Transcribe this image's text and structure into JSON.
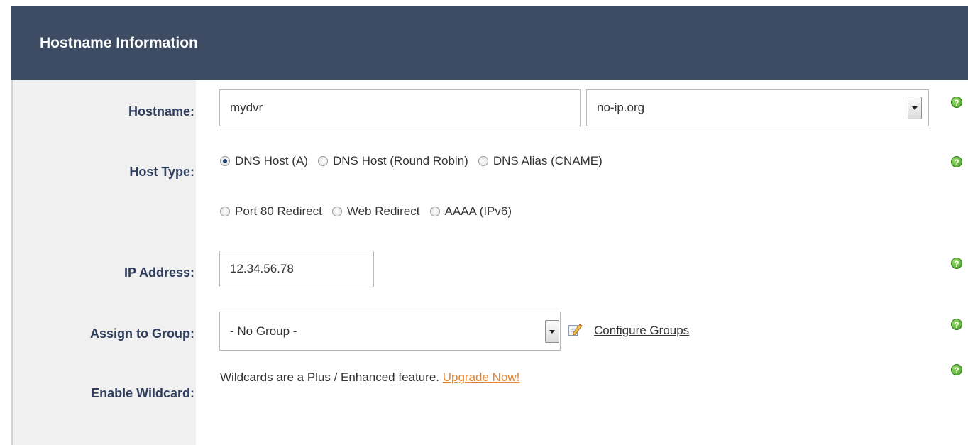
{
  "header": {
    "title": "Hostname Information"
  },
  "fields": {
    "hostname": {
      "label": "Hostname:",
      "value": "mydvr",
      "domain": "no-ip.org"
    },
    "host_type": {
      "label": "Host Type:",
      "options": [
        {
          "label": "DNS Host (A)",
          "checked": true
        },
        {
          "label": "DNS Host (Round Robin)",
          "checked": false
        },
        {
          "label": "DNS Alias (CNAME)",
          "checked": false
        },
        {
          "label": "Port 80 Redirect",
          "checked": false
        },
        {
          "label": "Web Redirect",
          "checked": false
        },
        {
          "label": "AAAA (IPv6)",
          "checked": false
        }
      ]
    },
    "ip_address": {
      "label": "IP Address:",
      "value": "12.34.56.78"
    },
    "group": {
      "label": "Assign to Group:",
      "value": "- No Group -",
      "configure_link": "Configure Groups"
    },
    "wildcard": {
      "label": "Enable Wildcard:",
      "message": "Wildcards are a Plus / Enhanced feature.",
      "upgrade_link": "Upgrade Now!"
    }
  },
  "icons": {
    "help": "help-icon",
    "edit": "edit-icon"
  },
  "colors": {
    "header_bg": "#3d4b63",
    "label_text": "#2f3e5c",
    "link": "#e8822a",
    "help_green": "#4caf24"
  }
}
